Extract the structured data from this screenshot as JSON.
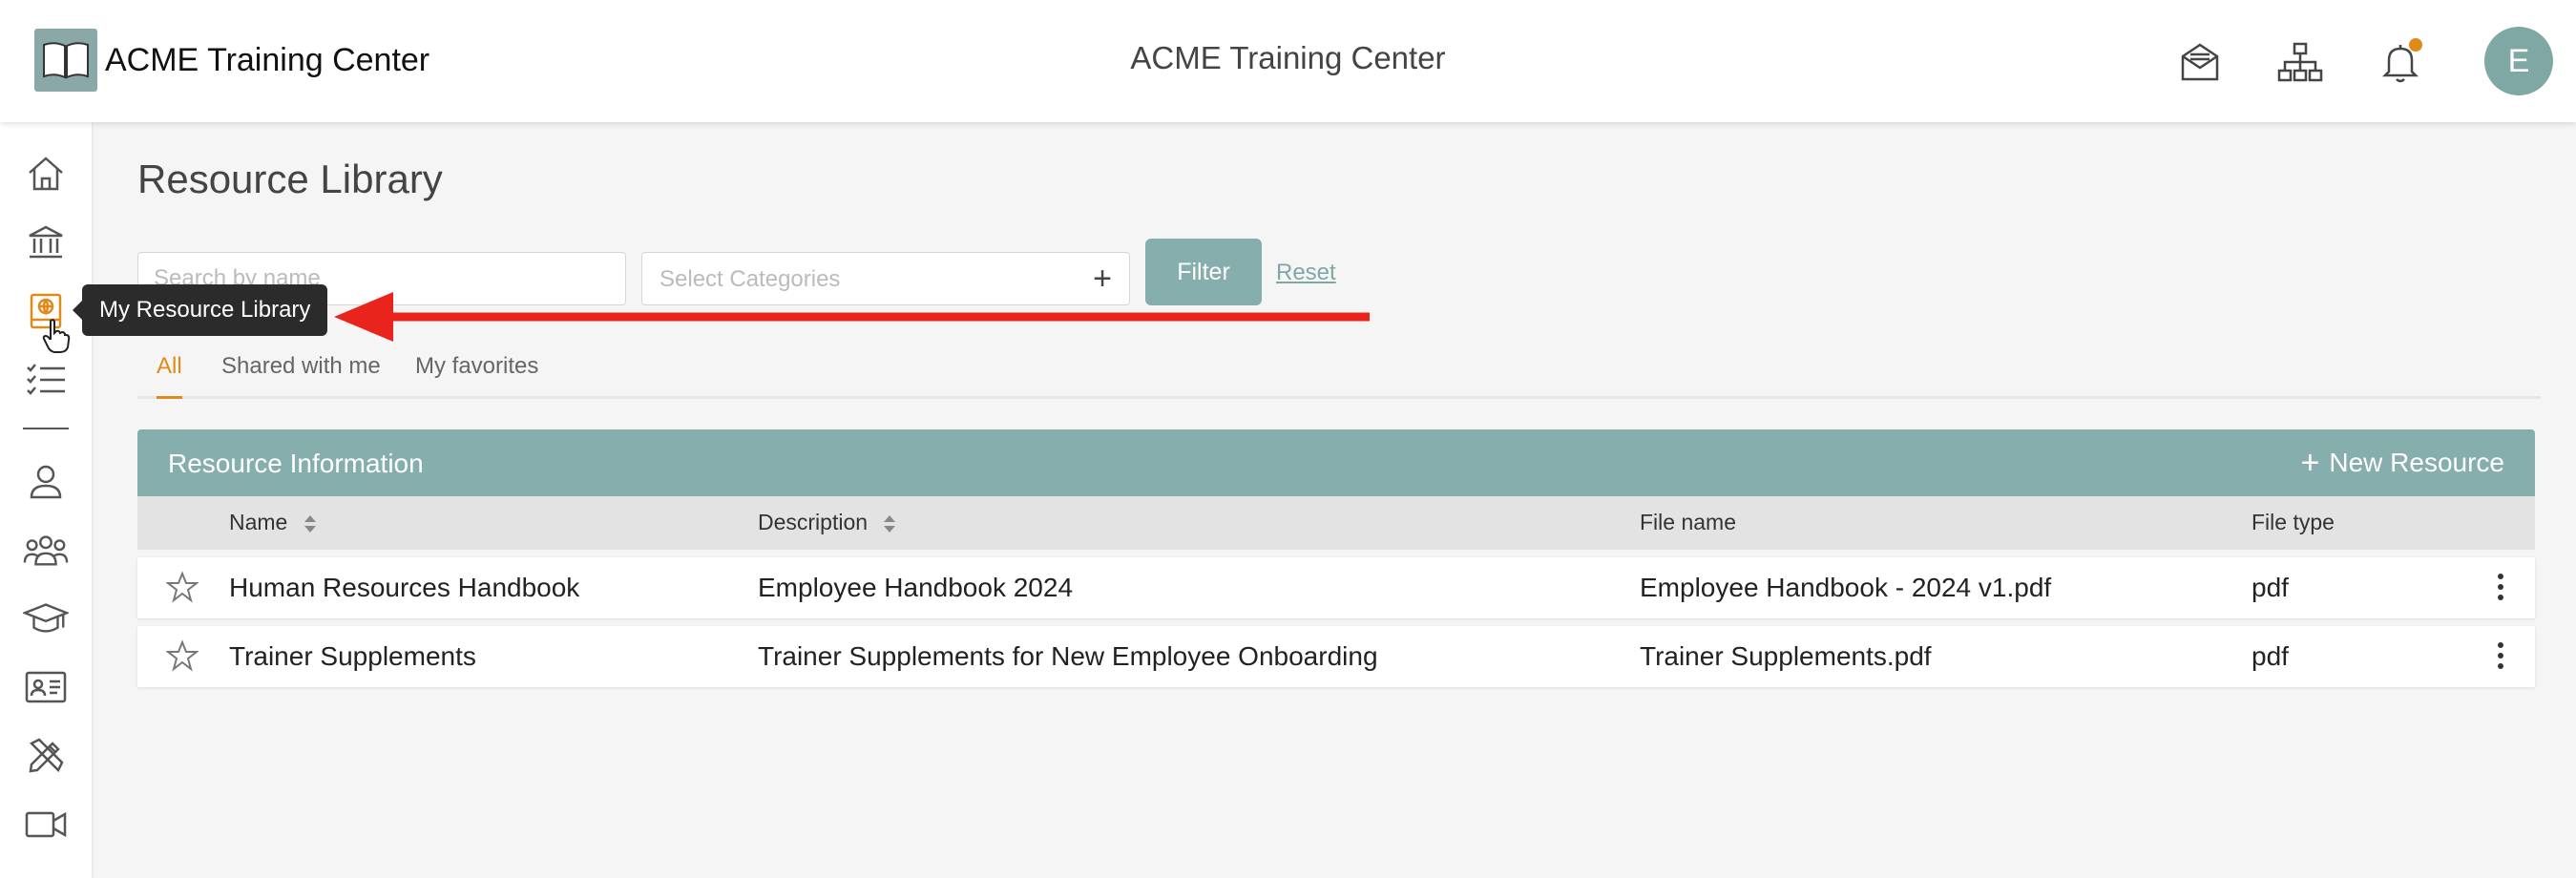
{
  "header": {
    "brand_name": "ACME Training Center",
    "center_title": "ACME Training Center",
    "avatar_initial": "E",
    "notification_dot_color": "#e08a1a"
  },
  "sidebar": {
    "tooltip": "My Resource Library",
    "items": [
      {
        "icon": "home-icon"
      },
      {
        "icon": "institution-icon"
      },
      {
        "icon": "resource-library-icon",
        "active": true
      },
      {
        "icon": "checklist-icon"
      },
      {
        "icon": "user-icon"
      },
      {
        "icon": "users-group-icon"
      },
      {
        "icon": "graduation-cap-icon"
      },
      {
        "icon": "id-card-icon"
      },
      {
        "icon": "design-tools-icon"
      },
      {
        "icon": "video-camera-icon"
      }
    ]
  },
  "main": {
    "page_title": "Resource Library",
    "search_placeholder": "Search by name",
    "categories_placeholder": "Select Categories",
    "filter_label": "Filter",
    "reset_label": "Reset",
    "tabs": [
      {
        "label": "All",
        "active": true
      },
      {
        "label": "Shared with me"
      },
      {
        "label": "My favorites"
      }
    ]
  },
  "table": {
    "title": "Resource Information",
    "new_button": "New Resource",
    "columns": [
      "Name",
      "Description",
      "File name",
      "File type"
    ],
    "rows": [
      {
        "name": "Human Resources Handbook",
        "description": "Employee Handbook 2024",
        "file_name": "Employee Handbook - 2024 v1.pdf",
        "file_type": "pdf"
      },
      {
        "name": "Trainer Supplements",
        "description": "Trainer Supplements for New Employee Onboarding",
        "file_name": "Trainer Supplements.pdf",
        "file_type": "pdf"
      }
    ]
  },
  "colors": {
    "accent": "#86aead",
    "active_tab": "#e08a1a",
    "annotation_arrow": "#e8241c"
  }
}
